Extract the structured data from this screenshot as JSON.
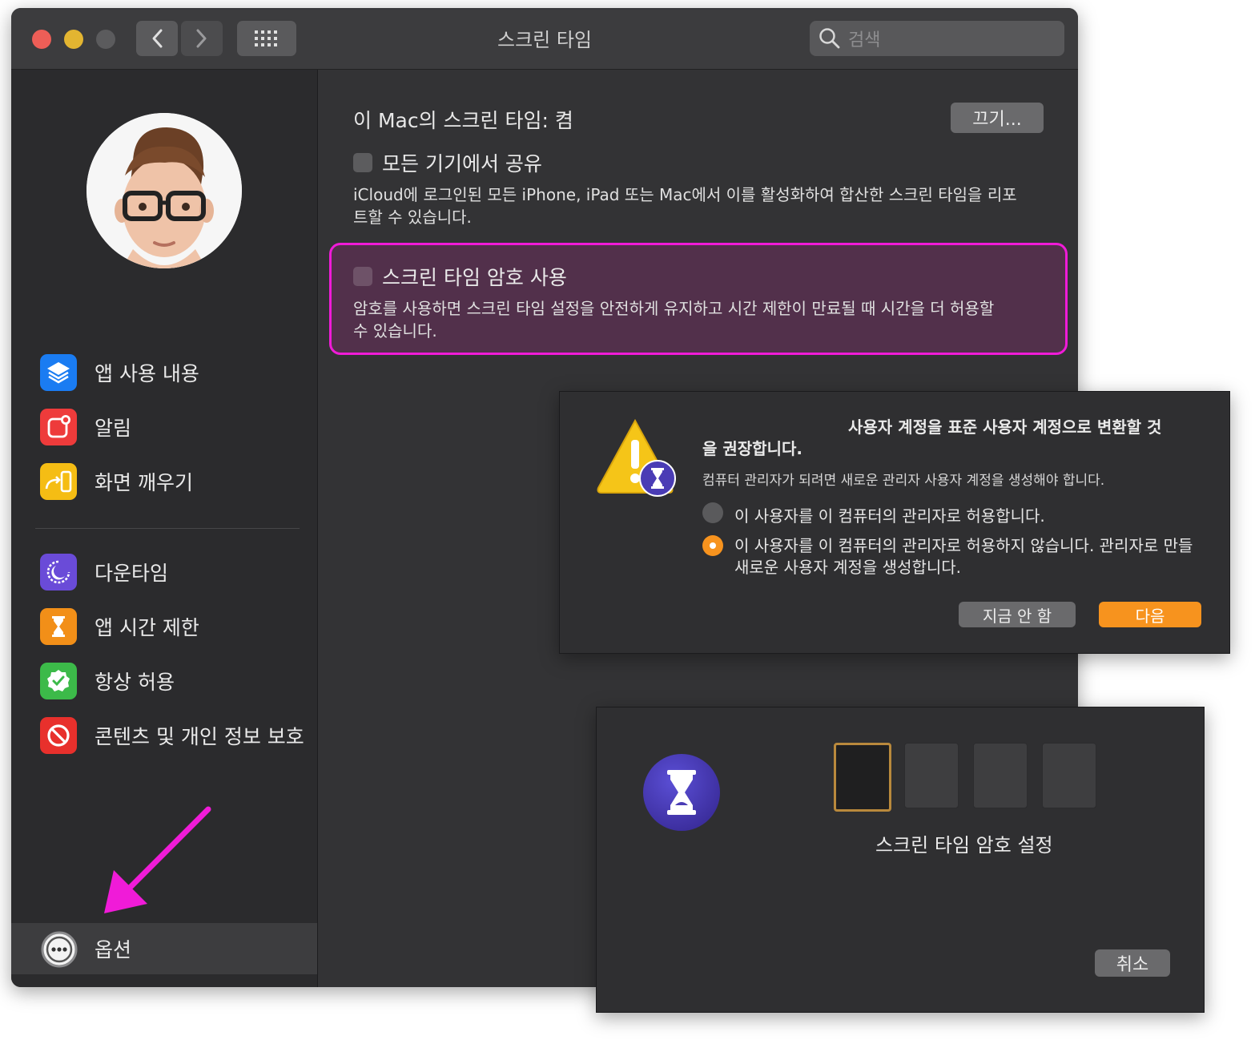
{
  "window": {
    "title": "스크린 타임",
    "search_placeholder": "검색"
  },
  "sidebar": {
    "items": [
      {
        "label": "앱 사용 내용"
      },
      {
        "label": "알림"
      },
      {
        "label": "화면 깨우기"
      },
      {
        "label": "다운타임"
      },
      {
        "label": "앱 시간 제한"
      },
      {
        "label": "항상 허용"
      },
      {
        "label": "콘텐츠 및 개인 정보 보호"
      }
    ],
    "options_label": "옵션"
  },
  "main": {
    "status_label": "이 Mac의 스크린 타임: 켬",
    "turn_off_button": "끄기...",
    "share_label": "모든 기기에서 공유",
    "share_desc_line1": "iCloud에 로그인된 모든 iPhone, iPad 또는 Mac에서 이를 활성화하여 합산한 스크린 타임을 리포",
    "share_desc_line2": "트할 수 있습니다.",
    "passcode_label": "스크린 타임 암호 사용",
    "passcode_desc_line1": "암호를 사용하면 스크린 타임 설정을 안전하게 유지하고 시간 제한이 만료될 때 시간을 더 허용할",
    "passcode_desc_line2": "수 있습니다."
  },
  "dialog_convert": {
    "title_line1": "사용자 계정을 표준 사용자 계정으로 변환할 것",
    "title_line2": "을 권장합니다.",
    "subtitle": "컴퓨터 관리자가 되려면 새로운 관리자 사용자 계정을 생성해야 합니다.",
    "option1": "이 사용자를 이 컴퓨터의 관리자로 허용합니다.",
    "option2_line1": "이 사용자를 이 컴퓨터의 관리자로 허용하지 않습니다. 관리자로 만들",
    "option2_line2": "새로운 사용자 계정을 생성합니다.",
    "selected_option": 2,
    "not_now_button": "지금 안 함",
    "next_button": "다음",
    "accent_color": "#f7931e"
  },
  "dialog_passcode": {
    "label": "스크린 타임 암호 설정",
    "digits": 4,
    "cancel_button": "취소"
  },
  "annotation": {
    "highlight_color": "#f01bd8"
  }
}
